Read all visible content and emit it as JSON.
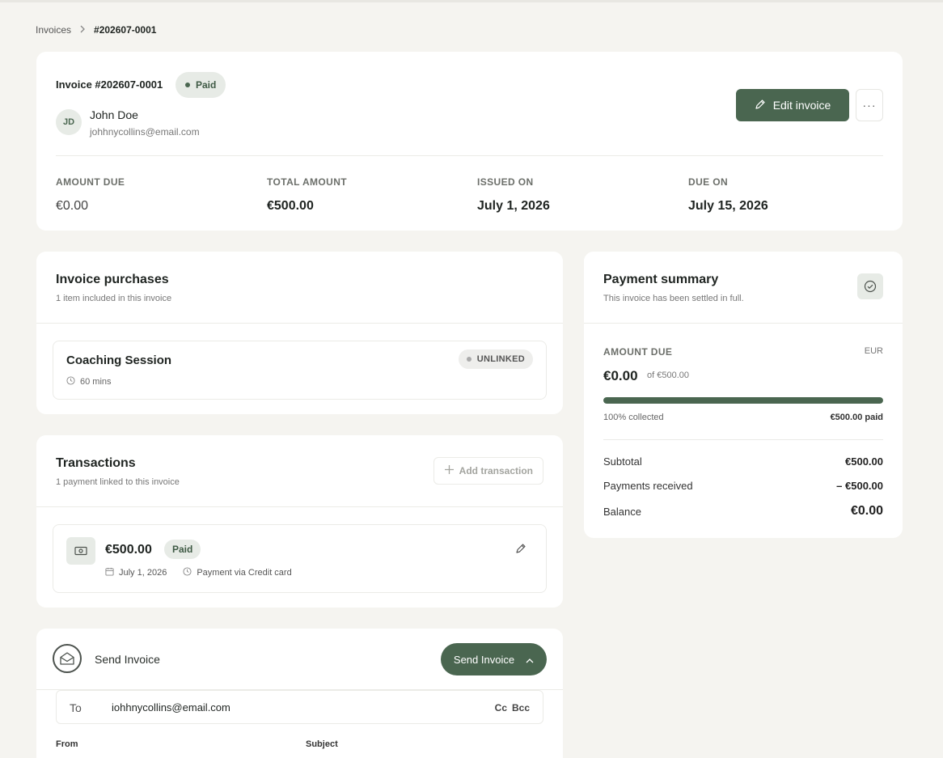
{
  "breadcrumb": {
    "root": "Invoices",
    "current": "#202607-0001"
  },
  "invoice": {
    "title": "Invoice #202607-0001",
    "status": "Paid",
    "customer": {
      "initials": "JD",
      "name": "John Doe",
      "email": "johhnycollins@email.com"
    },
    "edit_label": "Edit invoice",
    "more_label": "···",
    "stats": [
      {
        "label": "AMOUNT DUE",
        "value": "€0.00"
      },
      {
        "label": "TOTAL AMOUNT",
        "value": "€500.00"
      },
      {
        "label": "ISSUED ON",
        "value": "July 1, 2026"
      },
      {
        "label": "DUE ON",
        "value": "July 15, 2026"
      }
    ]
  },
  "purchases": {
    "title": "Invoice purchases",
    "subtitle": "1 item included in this invoice",
    "item": {
      "name": "Coaching Session",
      "duration": "60 mins",
      "badge": "UNLINKED"
    }
  },
  "transactions": {
    "title": "Transactions",
    "subtitle": "1 payment linked to this invoice",
    "add_label": "Add transaction",
    "tx": {
      "amount": "€500.00",
      "status": "Paid",
      "date": "July 1, 2026",
      "method": "Payment via Credit card"
    }
  },
  "send": {
    "title": "Send Invoice",
    "button_label": "Send Invoice",
    "to_label": "To",
    "to_value": "iohhnycollins@email.com",
    "cc": "Cc",
    "bcc": "Bcc",
    "from_label": "From",
    "subject_label": "Subject"
  },
  "summary": {
    "title": "Payment summary",
    "subtitle": "This invoice has been settled in full.",
    "amount_label": "AMOUNT DUE",
    "currency": "EUR",
    "amount": "€0.00",
    "of_total": "of €500.00",
    "collected_fraction": 1.0,
    "collected_label": "100% collected",
    "paid_label": "€500.00 paid",
    "rows": [
      {
        "label": "Subtotal",
        "value": "€500.00"
      },
      {
        "label": "Payments received",
        "value": "– €500.00"
      },
      {
        "label": "Balance",
        "value": "€0.00"
      }
    ]
  },
  "colors": {
    "accent": "#4a6650",
    "badge_bg": "#e7ebe6",
    "page_bg": "#f5f4f0"
  }
}
